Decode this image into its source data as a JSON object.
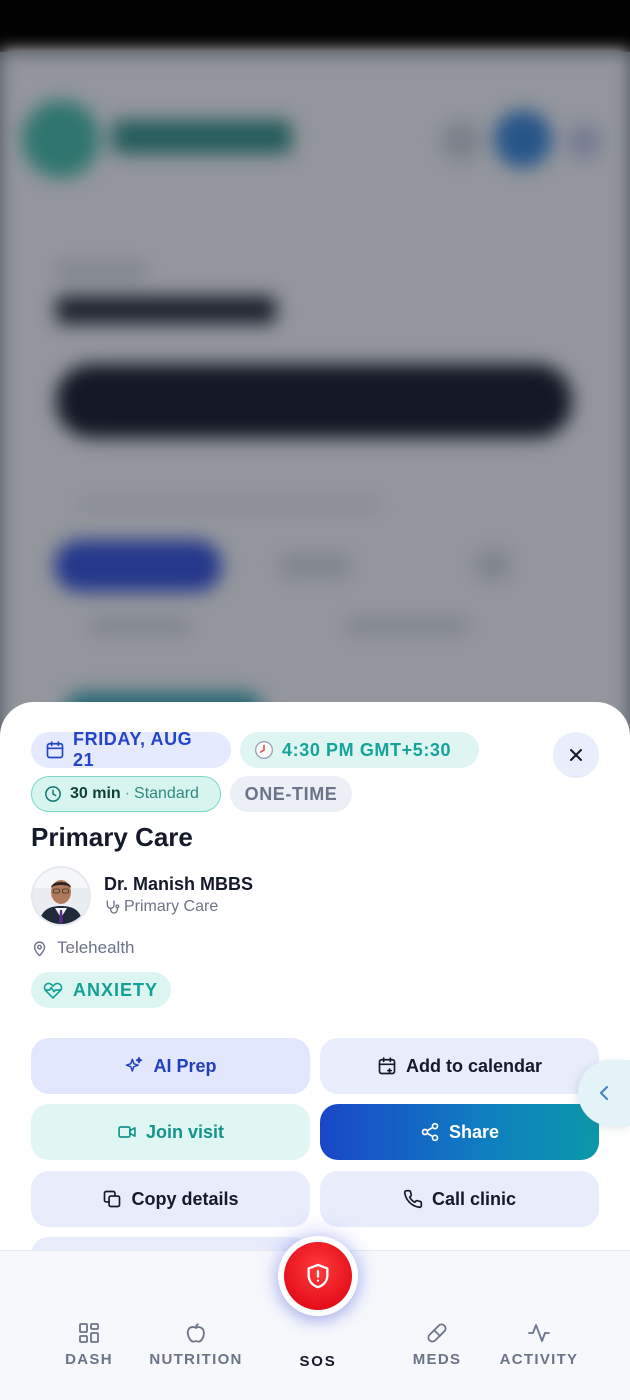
{
  "appointment": {
    "date": "FRIDAY, AUG 21",
    "time": "4:30 PM GMT+5:30",
    "duration": "30 min",
    "duration_separator": "·",
    "visit_type": "Standard",
    "recurrence": "ONE-TIME",
    "title": "Primary Care",
    "doctor_name": "Dr. Manish MBBS",
    "doctor_specialty": "Primary Care",
    "location": "Telehealth",
    "tag": "ANXIETY"
  },
  "actions": {
    "ai_prep": "AI Prep",
    "add_to_calendar": "Add to calendar",
    "join_visit": "Join visit",
    "share": "Share",
    "copy_details": "Copy details",
    "call_clinic": "Call clinic"
  },
  "nav": {
    "dash": "DASH",
    "nutrition": "NUTRITION",
    "sos": "SOS",
    "meds": "MEDS",
    "activity": "ACTIVITY"
  },
  "colors": {
    "primary_blue": "#2545c8",
    "teal": "#16a39a",
    "sos_red": "#e5101c",
    "text_dark": "#141a29",
    "text_muted": "#6b7488"
  },
  "icons": {
    "date": "calendar-icon",
    "time": "clock-icon",
    "duration": "timer-icon",
    "close": "close-icon",
    "specialty": "stethoscope-icon",
    "location": "map-pin-icon",
    "tag": "heart-pulse-icon",
    "ai_prep": "sparkles-icon",
    "add_to_calendar": "calendar-plus-icon",
    "join_visit": "video-icon",
    "share": "share-icon",
    "copy_details": "copy-icon",
    "call_clinic": "phone-icon",
    "side_tab": "chevron-left-icon",
    "dash": "grid-icon",
    "nutrition": "apple-icon",
    "sos": "shield-alert-icon",
    "meds": "pill-icon",
    "activity": "activity-icon"
  }
}
